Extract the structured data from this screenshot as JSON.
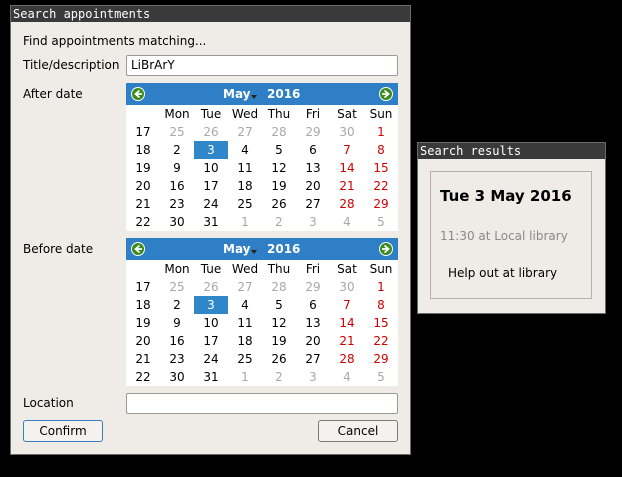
{
  "search_window": {
    "title": "Search appointments",
    "heading": "Find appointments matching...",
    "title_label": "Title/description",
    "title_value": "LiBrArY",
    "after_label": "After date",
    "before_label": "Before date",
    "location_label": "Location",
    "location_value": "",
    "confirm_label": "Confirm",
    "cancel_label": "Cancel"
  },
  "calendar_weekday_headers": [
    "Mon",
    "Tue",
    "Wed",
    "Thu",
    "Fri",
    "Sat",
    "Sun"
  ],
  "after_calendar": {
    "month": "May",
    "year": "2016",
    "weeks": [
      {
        "week": "17",
        "days": [
          "25",
          "26",
          "27",
          "28",
          "29",
          "30",
          "1"
        ]
      },
      {
        "week": "18",
        "days": [
          "2",
          "3",
          "4",
          "5",
          "6",
          "7",
          "8"
        ]
      },
      {
        "week": "19",
        "days": [
          "9",
          "10",
          "11",
          "12",
          "13",
          "14",
          "15"
        ]
      },
      {
        "week": "20",
        "days": [
          "16",
          "17",
          "18",
          "19",
          "20",
          "21",
          "22"
        ]
      },
      {
        "week": "21",
        "days": [
          "23",
          "24",
          "25",
          "26",
          "27",
          "28",
          "29"
        ]
      },
      {
        "week": "22",
        "days": [
          "30",
          "31",
          "1",
          "2",
          "3",
          "4",
          "5"
        ]
      }
    ],
    "selected_day": "3"
  },
  "before_calendar": {
    "month": "May",
    "year": "2016",
    "weeks": [
      {
        "week": "17",
        "days": [
          "25",
          "26",
          "27",
          "28",
          "29",
          "30",
          "1"
        ]
      },
      {
        "week": "18",
        "days": [
          "2",
          "3",
          "4",
          "5",
          "6",
          "7",
          "8"
        ]
      },
      {
        "week": "19",
        "days": [
          "9",
          "10",
          "11",
          "12",
          "13",
          "14",
          "15"
        ]
      },
      {
        "week": "20",
        "days": [
          "16",
          "17",
          "18",
          "19",
          "20",
          "21",
          "22"
        ]
      },
      {
        "week": "21",
        "days": [
          "23",
          "24",
          "25",
          "26",
          "27",
          "28",
          "29"
        ]
      },
      {
        "week": "22",
        "days": [
          "30",
          "31",
          "1",
          "2",
          "3",
          "4",
          "5"
        ]
      }
    ],
    "selected_day": "3"
  },
  "results_window": {
    "title": "Search results",
    "date": "Tue 3 May 2016",
    "time_location": "11:30 at Local library",
    "description": "Help out at library"
  },
  "colors": {
    "calendar_header": "#2f7fc7",
    "selected_day": "#2f86c9",
    "weekend": "#cc0000",
    "nav_button": "#3a8a1e",
    "window_bg": "#efebe7",
    "titlebar_bg": "#3a3a3a"
  }
}
